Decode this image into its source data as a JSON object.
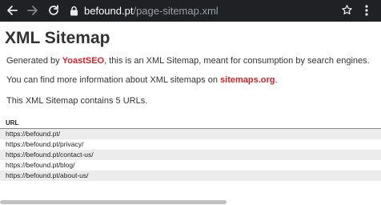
{
  "browser": {
    "url_host": "befound.pt",
    "url_path": "/page-sitemap.xml",
    "icons": {
      "back": "back-arrow-icon",
      "forward": "forward-arrow-icon",
      "reload": "reload-icon",
      "lock": "lock-icon",
      "bookmark": "star-icon",
      "menu": "kebab-menu-icon"
    }
  },
  "page": {
    "title": "XML Sitemap",
    "intro_prefix": "Generated by ",
    "intro_link": "YoastSEO",
    "intro_suffix": ", this is an XML Sitemap, meant for consumption by search engines.",
    "info_prefix": "You can find more information about XML sitemaps on ",
    "info_link": "sitemaps.org",
    "info_suffix": ".",
    "count_text": "This XML Sitemap contains 5 URLs.",
    "table_header": "URL",
    "urls": [
      "https://befound.pt/",
      "https://befound.pt/privacy/",
      "https://befound.pt/contact-us/",
      "https://befound.pt/blog/",
      "https://befound.pt/about-us/"
    ]
  },
  "colors": {
    "toolbar_bg": "#202124",
    "link": "#e01f24",
    "row_alt": "#ececec",
    "title": "#333333"
  }
}
